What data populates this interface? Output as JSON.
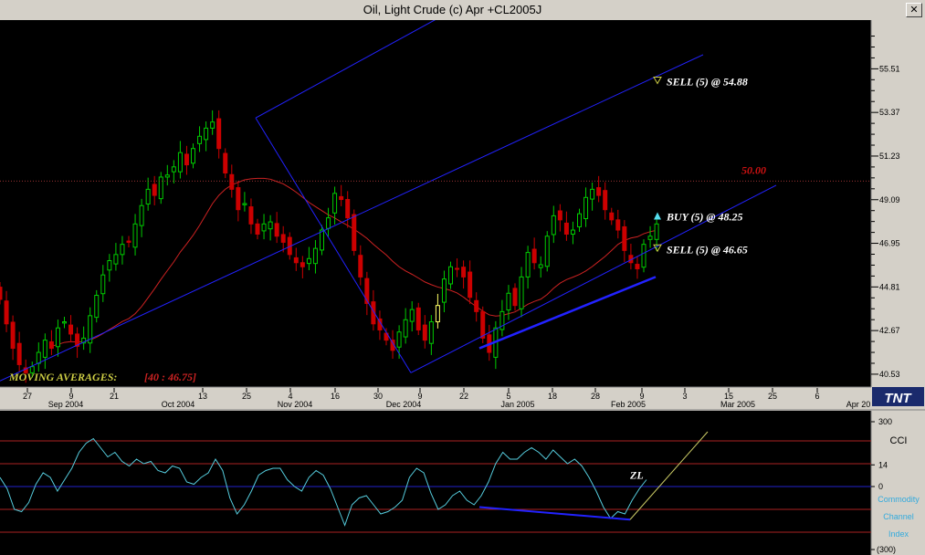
{
  "window": {
    "title": "Oil, Light Crude (c) Apr +CL2005J",
    "close_label": "✕"
  },
  "logo": "TNT",
  "colors": {
    "background": "#000000",
    "up_candle": "#00cc00",
    "down_candle": "#cc0000",
    "highlight_candle": "#ffff66",
    "moving_average": "#cc2222",
    "channel_lines": "#2222ff",
    "cci_line": "#55ccdd",
    "cci_zero": "#2222cc",
    "cci_band": "#aa2222",
    "annotation_text": "#ffffff",
    "price_level_text": "#cc1111",
    "ma_label": "#cccc44",
    "ma_value": "#cc2222",
    "trend_line": "#cccc66"
  },
  "chart_data": [
    {
      "type": "candlestick",
      "ylim": [
        39.9,
        57.9
      ],
      "y_ticks": [
        "55.51",
        "53.37",
        "51.23",
        "49.09",
        "46.95",
        "44.81",
        "42.67",
        "40.53"
      ],
      "x_day_ticks": [
        "27",
        "9",
        "21",
        "13",
        "25",
        "4",
        "16",
        "30",
        "9",
        "22",
        "5",
        "18",
        "28",
        "9",
        "3",
        "15",
        "25",
        "6"
      ],
      "x_month_ticks": [
        "Sep 2004",
        "Oct 2004",
        "Nov 2004",
        "Dec 2004",
        "Jan 2005",
        "Feb 2005",
        "Mar 2005",
        "Apr 20"
      ],
      "close": [
        44.2,
        43.0,
        41.8,
        41.0,
        40.6,
        40.9,
        41.6,
        42.2,
        41.8,
        42.8,
        43.1,
        42.5,
        41.9,
        42.3,
        43.4,
        44.4,
        45.4,
        46.1,
        46.4,
        46.9,
        47.0,
        47.9,
        48.8,
        49.6,
        49.3,
        50.2,
        50.3,
        50.7,
        51.4,
        50.8,
        51.6,
        52.2,
        52.6,
        52.9,
        51.6,
        50.4,
        49.6,
        48.6,
        48.9,
        47.9,
        47.4,
        47.9,
        48.0,
        47.3,
        47.0,
        46.4,
        46.0,
        45.8,
        46.2,
        46.7,
        47.6,
        48.2,
        49.4,
        49.1,
        48.2,
        46.6,
        45.3,
        44.0,
        43.0,
        42.7,
        42.2,
        41.7,
        42.6,
        43.2,
        43.7,
        42.7,
        42.2,
        43.1,
        43.9,
        45.2,
        45.8,
        45.7,
        45.3,
        44.3,
        43.6,
        42.3,
        41.6,
        42.8,
        43.6,
        44.5,
        43.9,
        45.3,
        46.5,
        46.0,
        45.9,
        47.3,
        48.3,
        48.1,
        47.4,
        47.6,
        48.4,
        49.2,
        49.6,
        49.3,
        48.6,
        48.1,
        47.6,
        46.6,
        46.0,
        45.7,
        46.9,
        47.3,
        47.9
      ],
      "ma_label": "MOVING AVERAGES:",
      "ma_value": "[40 : 46.75]",
      "price_level": "50.00",
      "annotations": [
        {
          "label": "SELL (5) @ 54.88",
          "marker": "triangle-down-outline"
        },
        {
          "label": "BUY (5) @ 48.25",
          "marker": "triangle-up"
        },
        {
          "label": "SELL (5) @ 46.65",
          "marker": "triangle-down-outline"
        }
      ]
    },
    {
      "type": "line",
      "name": "Commodity Channel Index",
      "short_name": "CCI",
      "ylim": [
        -300,
        300
      ],
      "y_ticks": [
        "300",
        "14",
        "0",
        "(300)"
      ],
      "bands": [
        200,
        100,
        -100,
        -200
      ],
      "annotation": "ZL",
      "values": [
        40,
        -10,
        -100,
        -110,
        -70,
        10,
        60,
        40,
        -20,
        30,
        80,
        150,
        190,
        210,
        170,
        130,
        150,
        110,
        90,
        120,
        100,
        110,
        70,
        60,
        90,
        80,
        20,
        10,
        40,
        60,
        120,
        70,
        -50,
        -120,
        -80,
        -20,
        50,
        70,
        80,
        80,
        30,
        0,
        -20,
        40,
        70,
        50,
        -10,
        -90,
        -170,
        -80,
        -50,
        -40,
        -80,
        -120,
        -110,
        -90,
        -60,
        40,
        80,
        60,
        -30,
        -100,
        -80,
        -40,
        -20,
        -60,
        -80,
        -40,
        20,
        100,
        150,
        120,
        120,
        150,
        170,
        150,
        120,
        160,
        130,
        100,
        120,
        90,
        40,
        -20,
        -90,
        -140,
        -110,
        -120,
        -60,
        -10,
        30
      ]
    }
  ]
}
